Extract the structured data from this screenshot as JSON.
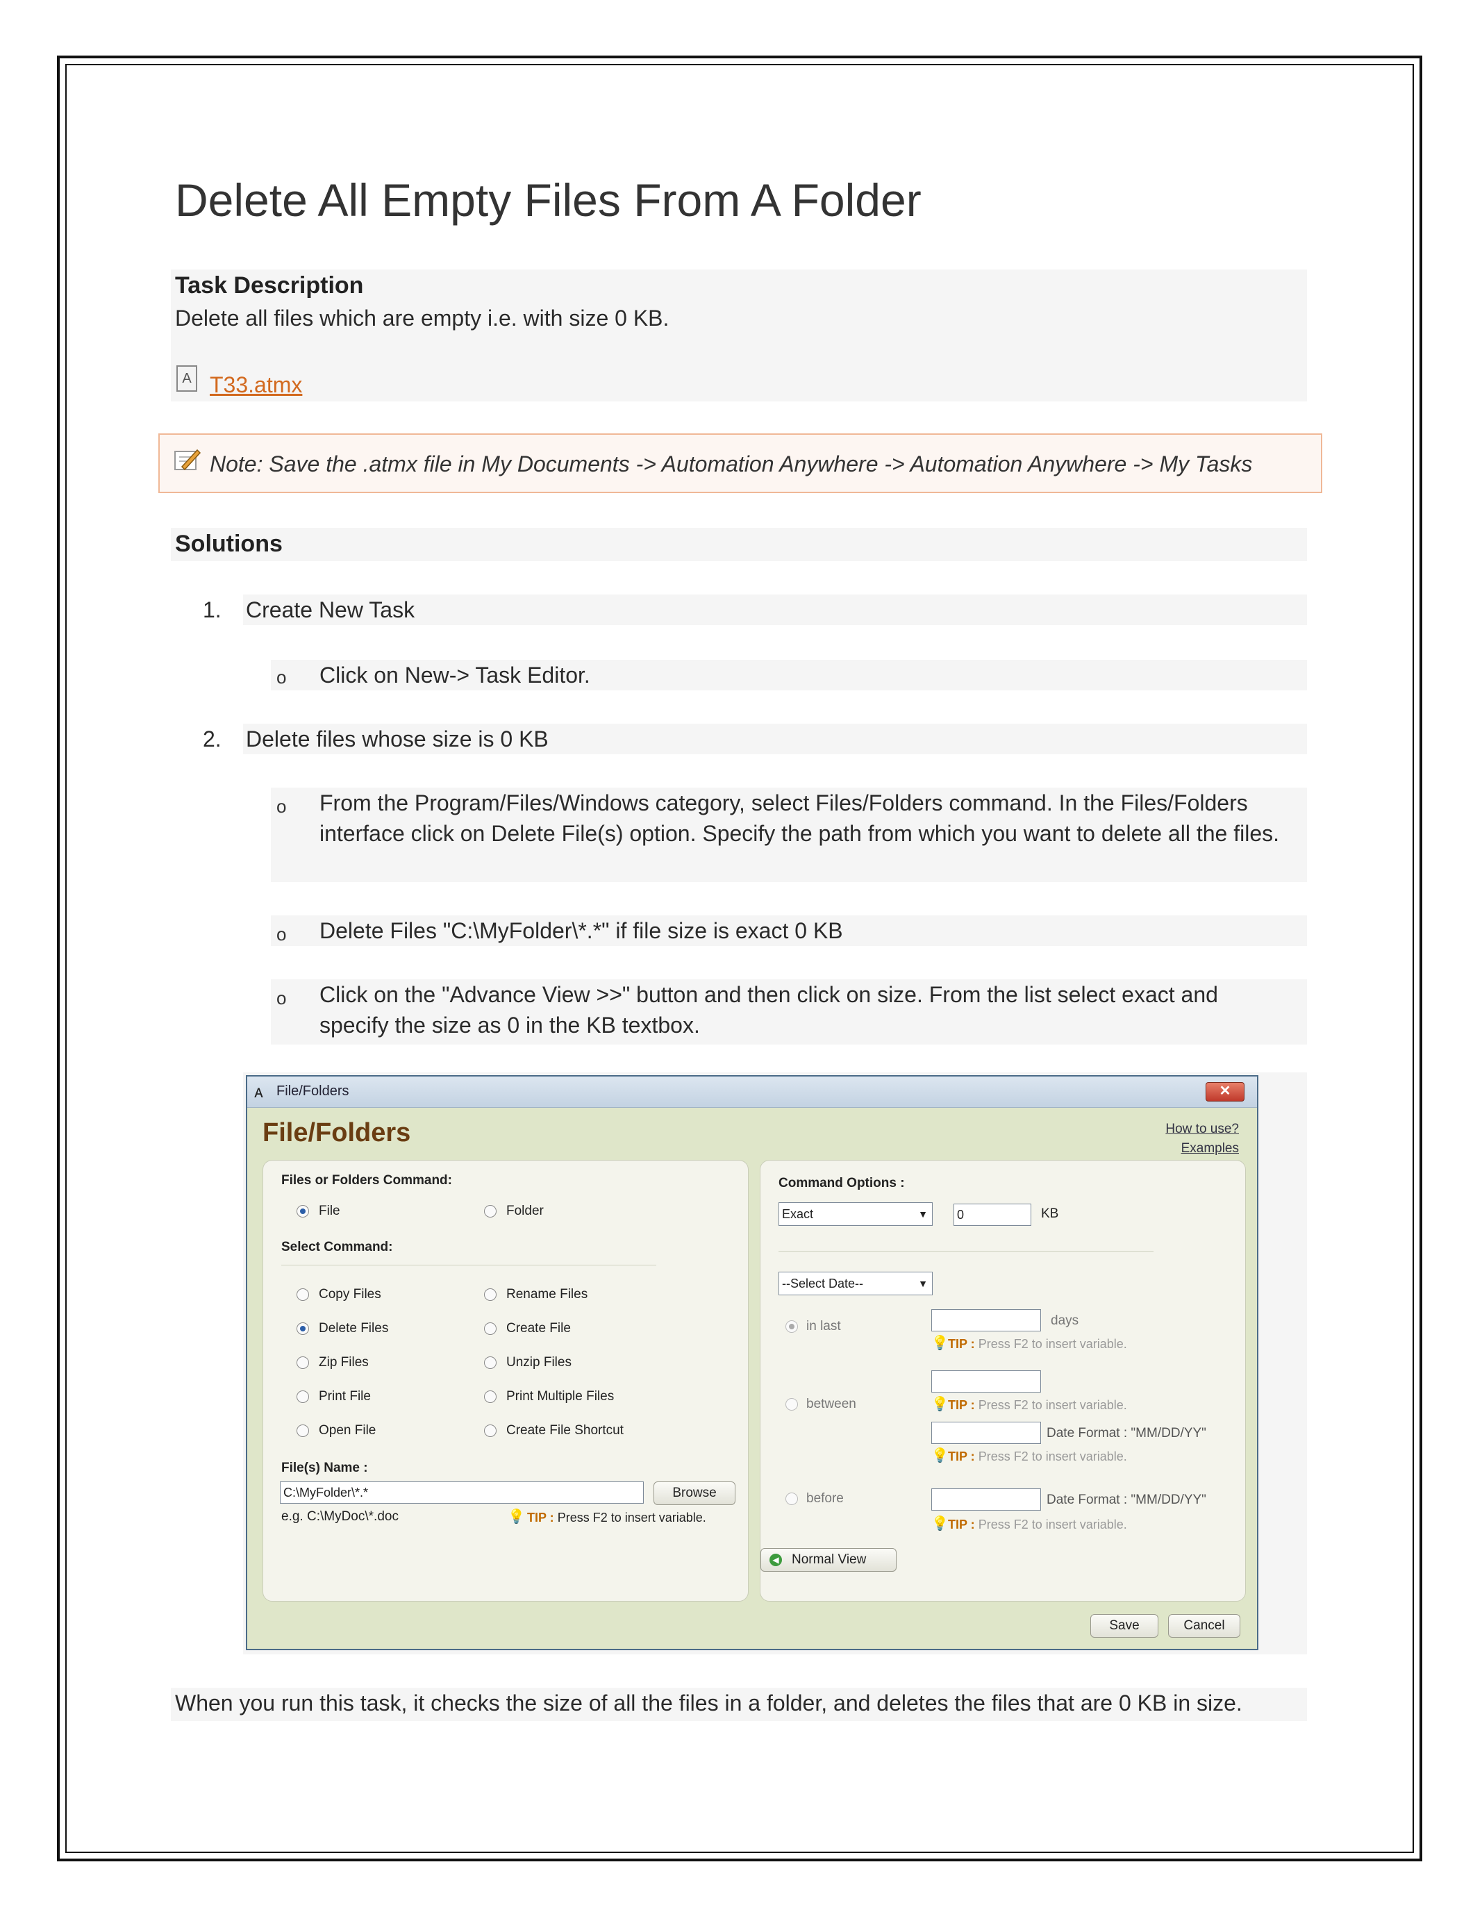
{
  "document": {
    "title": "Delete All Empty Files From A Folder",
    "task_description_heading": "Task Description",
    "task_description_text": "Delete all files which are empty i.e. with size 0 KB.",
    "attachment_link": "T33.atmx",
    "note": "Note: Save the .atmx file in My Documents -> Automation Anywhere -> Automation Anywhere -> My Tasks",
    "solutions_heading": "Solutions",
    "steps": [
      {
        "num": "1.",
        "text": "Create New Task",
        "bullets": [
          "Click on New-> Task Editor."
        ]
      },
      {
        "num": "2.",
        "text": "Delete files whose size is 0 KB",
        "bullets": [
          "From the Program/Files/Windows category, select Files/Folders command. In the Files/Folders interface click on Delete File(s) option. Specify the path from which you want to delete all the files.",
          "Delete Files \"C:\\MyFolder\\*.*\" if file size is exact 0 KB",
          "Click on the \"Advance View >>\" button and then click on size. From the list select exact and specify the size as 0 in the KB textbox."
        ]
      }
    ],
    "closing": "When you run this task, it checks the size of all the files in a folder, and deletes the files that are 0 KB in size.",
    "bullet_glyph": "o"
  },
  "dialog": {
    "window_title": "File/Folders",
    "heading": "File/Folders",
    "close_glyph": "✕",
    "links": {
      "how_to_use": "How to use?",
      "examples": "Examples"
    },
    "left": {
      "group_label": "Files or Folders Command:",
      "type_options": [
        {
          "label": "File",
          "selected": true
        },
        {
          "label": "Folder",
          "selected": false
        }
      ],
      "select_command_label": "Select Command:",
      "commands": [
        {
          "label": "Copy Files",
          "selected": false
        },
        {
          "label": "Rename Files",
          "selected": false
        },
        {
          "label": "Delete Files",
          "selected": true
        },
        {
          "label": "Create File",
          "selected": false
        },
        {
          "label": "Zip Files",
          "selected": false
        },
        {
          "label": "Unzip Files",
          "selected": false
        },
        {
          "label": "Print File",
          "selected": false
        },
        {
          "label": "Print Multiple Files",
          "selected": false
        },
        {
          "label": "Open File",
          "selected": false
        },
        {
          "label": "Create File Shortcut",
          "selected": false
        }
      ],
      "files_name_label": "File(s) Name :",
      "files_name_value": "C:\\MyFolder\\*.*",
      "browse_label": "Browse",
      "example_text": "e.g. C:\\MyDoc\\*.doc",
      "tip_prefix": "TIP :",
      "tip_text": "Press F2 to insert variable."
    },
    "right": {
      "command_options_label": "Command Options :",
      "size_mode": "Exact",
      "size_value": "0",
      "size_unit": "KB",
      "date_select": "--Select Date--",
      "in_last_label": "in last",
      "days_label": "days",
      "between_label": "between",
      "before_label": "before",
      "date_format_label": "Date Format : \"MM/DD/YY\"",
      "tip_prefix": "TIP :",
      "tip_text": "Press F2 to insert variable.",
      "normal_view_label": "Normal View"
    },
    "save_label": "Save",
    "cancel_label": "Cancel"
  }
}
